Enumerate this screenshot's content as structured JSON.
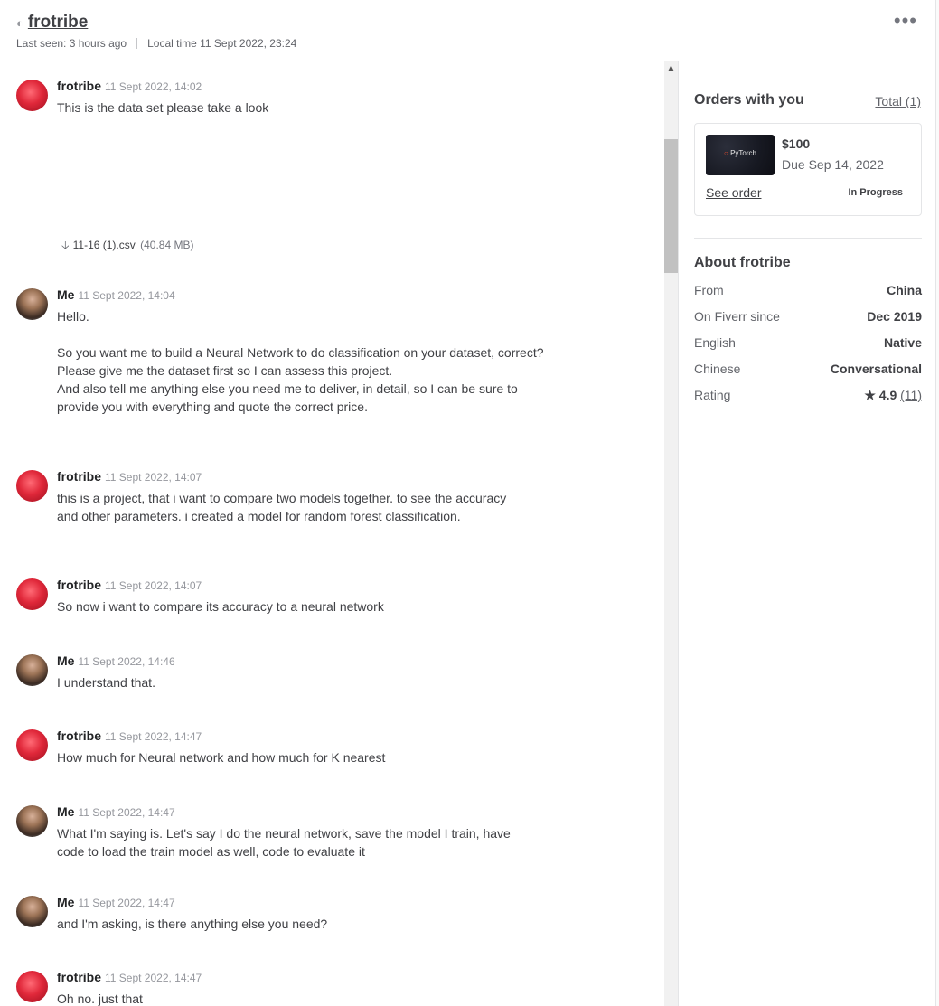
{
  "header": {
    "username": "frotribe",
    "last_seen": "Last seen: 3 hours ago",
    "local_time": "Local time 11 Sept 2022, 23:24",
    "more_icon": "more-horizontal-icon"
  },
  "messages": [
    {
      "sender": "frotribe",
      "time": "11 Sept 2022, 14:02",
      "avatar": "client",
      "lines": [
        "This is the data set please take a look"
      ],
      "attachment": {
        "name": "11-16 (1).csv",
        "size": "(40.84 MB)"
      }
    },
    {
      "sender": "Me",
      "time": "11 Sept 2022, 14:04",
      "avatar": "me",
      "lines": [
        "Hello.",
        "",
        "So you want me to build a Neural Network to do classification on your dataset, correct?",
        "Please give me the dataset first so I can assess this project.",
        "And also tell me anything else you need me to deliver, in detail, so I can be sure to provide you with everything and quote the correct price."
      ]
    },
    {
      "sender": "frotribe",
      "time": "11 Sept 2022, 14:07",
      "avatar": "client",
      "lines": [
        "this is a project, that i want to compare two models together. to see the accuracy and other parameters. i created a model for random forest classification."
      ]
    },
    {
      "sender": "frotribe",
      "time": "11 Sept 2022, 14:07",
      "avatar": "client",
      "lines": [
        "So now i want to compare its accuracy to a neural network"
      ]
    },
    {
      "sender": "Me",
      "time": "11 Sept 2022, 14:46",
      "avatar": "me",
      "lines": [
        "I understand that."
      ]
    },
    {
      "sender": "frotribe",
      "time": "11 Sept 2022, 14:47",
      "avatar": "client",
      "lines": [
        "How much for Neural network and how much for K nearest"
      ]
    },
    {
      "sender": "Me",
      "time": "11 Sept 2022, 14:47",
      "avatar": "me",
      "lines": [
        "What I'm saying is. Let's say I do the neural network, save the model I train, have code to load the train model as well, code to evaluate it"
      ]
    },
    {
      "sender": "Me",
      "time": "11 Sept 2022, 14:47",
      "avatar": "me",
      "lines": [
        "and I'm asking, is there anything else you need?"
      ]
    },
    {
      "sender": "frotribe",
      "time": "11 Sept 2022, 14:47",
      "avatar": "client",
      "lines": [
        "Oh no. just that"
      ]
    }
  ],
  "orders": {
    "title": "Orders with you",
    "total_label": "Total (1)",
    "card": {
      "thumb_text": "PyTorch",
      "price": "$100",
      "due": "Due Sep 14, 2022",
      "see_order": "See order",
      "status": "In Progress"
    }
  },
  "about": {
    "prefix": "About",
    "username": "frotribe",
    "rows": [
      {
        "label": "From",
        "value": "China"
      },
      {
        "label": "On Fiverr since",
        "value": "Dec 2019"
      },
      {
        "label": "English",
        "value": "Native"
      },
      {
        "label": "Chinese",
        "value": "Conversational"
      }
    ],
    "rating": {
      "label": "Rating",
      "value": "4.9",
      "reviews": "(11)"
    }
  }
}
